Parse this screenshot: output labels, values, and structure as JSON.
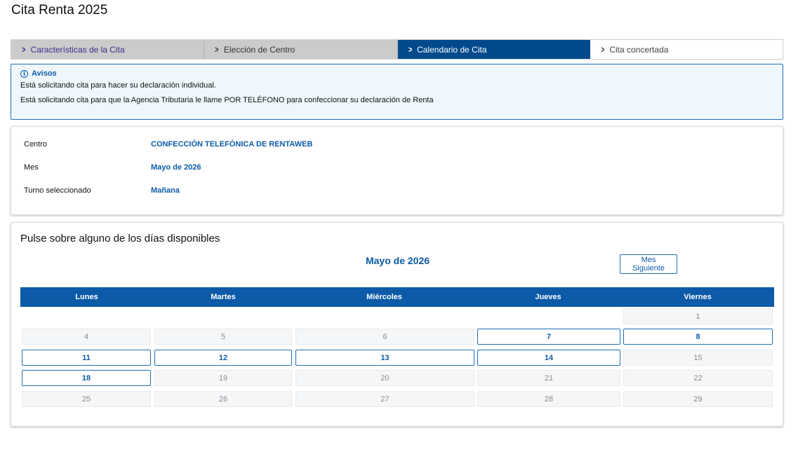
{
  "page_title": "Cita Renta 2025",
  "steps": [
    {
      "label": "Características de la Cita",
      "state": "done"
    },
    {
      "label": "Elección de Centro",
      "state": "done"
    },
    {
      "label": "Calendario de Cita",
      "state": "current"
    },
    {
      "label": "Cita concertada",
      "state": "pending"
    }
  ],
  "avisos": {
    "title": "Avisos",
    "lines": [
      "Está solicitando cita para hacer su declaración individual.",
      "Está solicitando cita para que la Agencia Tributaria le llame POR TELÉFONO para confeccionar su declaración de Renta"
    ]
  },
  "details": {
    "centro_label": "Centro",
    "centro_value": "CONFECCIÓN TELEFÓNICA DE RENTAWEB",
    "mes_label": "Mes",
    "mes_value": "Mayo de 2026",
    "turno_label": "Turno seleccionado",
    "turno_value": "Mañana"
  },
  "calendar": {
    "instruction": "Pulse sobre alguno de los días disponibles",
    "month_title": "Mayo de 2026",
    "next_button": "Mes Siguiente",
    "weekdays": [
      "Lunes",
      "Martes",
      "Miércoles",
      "Jueves",
      "Viernes"
    ],
    "weeks": [
      [
        null,
        null,
        null,
        null,
        {
          "day": "1",
          "available": false
        }
      ],
      [
        {
          "day": "4",
          "available": false
        },
        {
          "day": "5",
          "available": false
        },
        {
          "day": "6",
          "available": false
        },
        {
          "day": "7",
          "available": true
        },
        {
          "day": "8",
          "available": true
        }
      ],
      [
        {
          "day": "11",
          "available": true
        },
        {
          "day": "12",
          "available": true
        },
        {
          "day": "13",
          "available": true
        },
        {
          "day": "14",
          "available": true
        },
        {
          "day": "15",
          "available": false
        }
      ],
      [
        {
          "day": "18",
          "available": true
        },
        {
          "day": "19",
          "available": false
        },
        {
          "day": "20",
          "available": false
        },
        {
          "day": "21",
          "available": false
        },
        {
          "day": "22",
          "available": false
        }
      ],
      [
        {
          "day": "25",
          "available": false
        },
        {
          "day": "26",
          "available": false
        },
        {
          "day": "27",
          "available": false
        },
        {
          "day": "28",
          "available": false
        },
        {
          "day": "29",
          "available": false
        }
      ]
    ]
  },
  "colors": {
    "primary_blue": "#0c5aa8",
    "current_step_bg": "#004a8c",
    "done_step_bg": "#cbcbcb",
    "avisos_bg": "#eef7fb"
  }
}
